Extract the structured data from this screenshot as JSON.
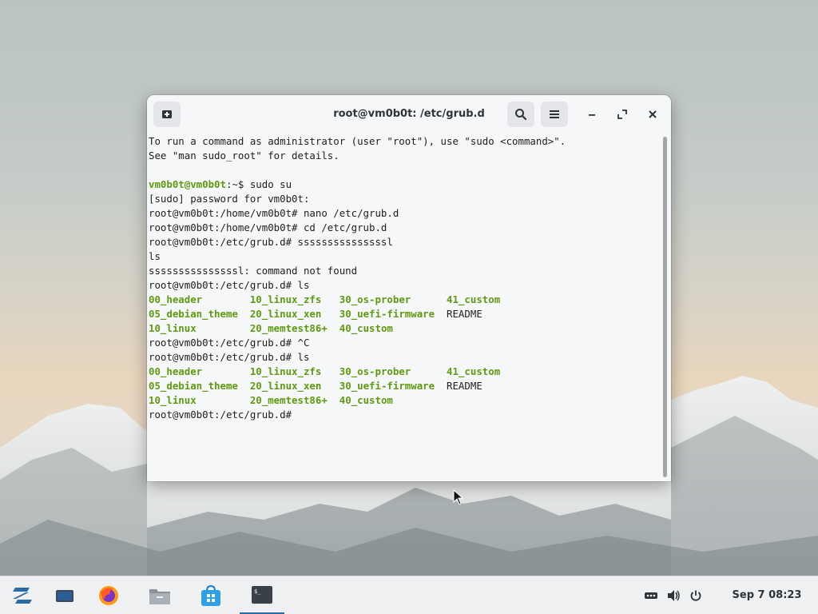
{
  "window": {
    "title": "root@vm0b0t: /etc/grub.d",
    "lines": [
      [
        {
          "t": "To run a command as administrator (user \"root\"), use \"sudo <command>\"."
        }
      ],
      [
        {
          "t": "See \"man sudo_root\" for details."
        }
      ],
      [
        {
          "t": ""
        }
      ],
      [
        {
          "t": "vm0b0t@vm0b0t",
          "g": true
        },
        {
          "t": ":~$ sudo su"
        }
      ],
      [
        {
          "t": "[sudo] password for vm0b0t:"
        }
      ],
      [
        {
          "t": "root@vm0b0t:/home/vm0b0t# nano /etc/grub.d"
        }
      ],
      [
        {
          "t": "root@vm0b0t:/home/vm0b0t# cd /etc/grub.d"
        }
      ],
      [
        {
          "t": "root@vm0b0t:/etc/grub.d# sssssssssssssssl"
        }
      ],
      [
        {
          "t": "ls"
        }
      ],
      [
        {
          "t": "sssssssssssssssl: command not found"
        }
      ],
      [
        {
          "t": "root@vm0b0t:/etc/grub.d# ls"
        }
      ],
      [
        {
          "t": "00_header        ",
          "g": true
        },
        {
          "t": "10_linux_zfs   ",
          "g": true
        },
        {
          "t": "30_os-prober      ",
          "g": true
        },
        {
          "t": "41_custom",
          "g": true
        }
      ],
      [
        {
          "t": "05_debian_theme  ",
          "g": true
        },
        {
          "t": "20_linux_xen   ",
          "g": true
        },
        {
          "t": "30_uefi-firmware  ",
          "g": true
        },
        {
          "t": "README"
        }
      ],
      [
        {
          "t": "10_linux         ",
          "g": true
        },
        {
          "t": "20_memtest86+  ",
          "g": true
        },
        {
          "t": "40_custom",
          "g": true
        }
      ],
      [
        {
          "t": "root@vm0b0t:/etc/grub.d# ^C"
        }
      ],
      [
        {
          "t": "root@vm0b0t:/etc/grub.d# ls"
        }
      ],
      [
        {
          "t": "00_header        ",
          "g": true
        },
        {
          "t": "10_linux_zfs   ",
          "g": true
        },
        {
          "t": "30_os-prober      ",
          "g": true
        },
        {
          "t": "41_custom",
          "g": true
        }
      ],
      [
        {
          "t": "05_debian_theme  ",
          "g": true
        },
        {
          "t": "20_linux_xen   ",
          "g": true
        },
        {
          "t": "30_uefi-firmware  ",
          "g": true
        },
        {
          "t": "README"
        }
      ],
      [
        {
          "t": "10_linux         ",
          "g": true
        },
        {
          "t": "20_memtest86+  ",
          "g": true
        },
        {
          "t": "40_custom",
          "g": true
        }
      ],
      [
        {
          "t": "root@vm0b0t:/etc/grub.d# "
        }
      ]
    ]
  },
  "taskbar": {
    "apps": [
      "zorin-menu-icon",
      "workspaces-icon",
      "firefox-icon",
      "files-icon",
      "software-store-icon",
      "terminal-icon"
    ],
    "active_app": "terminal-icon",
    "clock": "Sep 7  08:23"
  },
  "colors": {
    "prompt_green": "#5e9a10",
    "accent": "#2a6ba5"
  }
}
